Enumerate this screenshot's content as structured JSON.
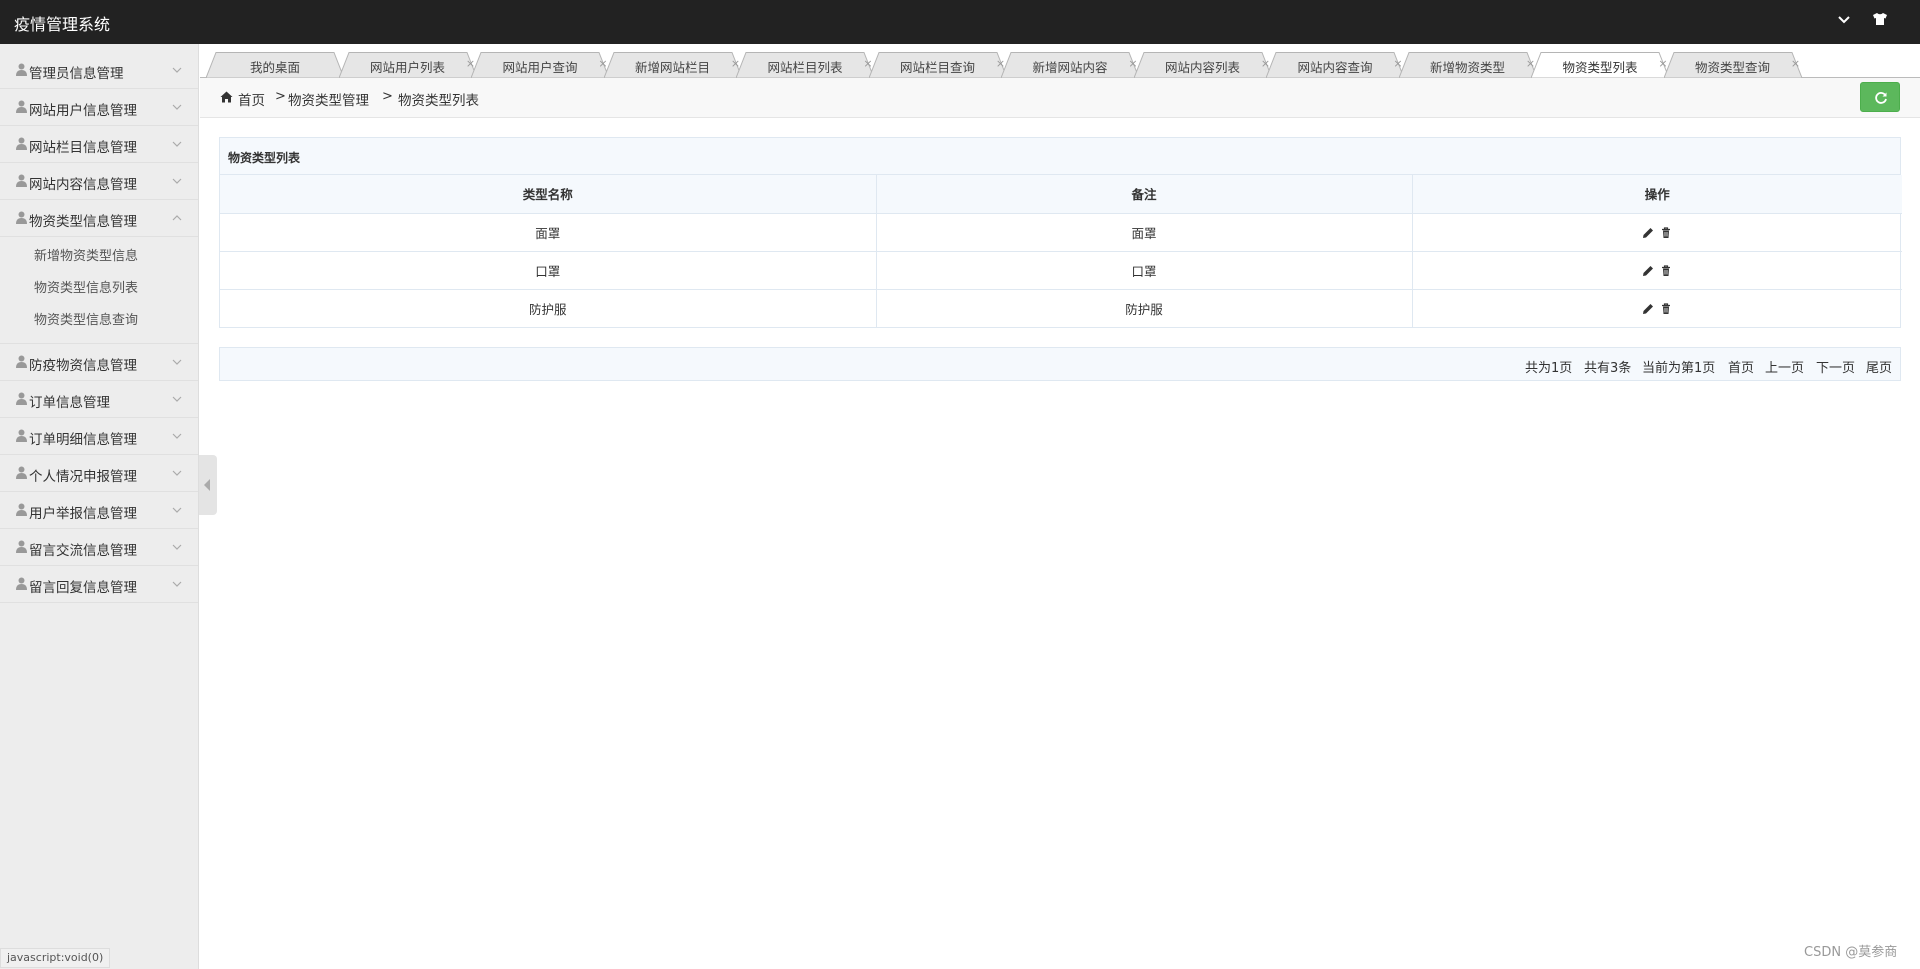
{
  "app": {
    "title": "疫情管理系统"
  },
  "sidebar": {
    "items": [
      {
        "label": "管理员信息管理"
      },
      {
        "label": "网站用户信息管理"
      },
      {
        "label": "网站栏目信息管理"
      },
      {
        "label": "网站内容信息管理"
      },
      {
        "label": "物资类型信息管理",
        "expanded": true,
        "children": [
          {
            "label": "新增物资类型信息"
          },
          {
            "label": "物资类型信息列表"
          },
          {
            "label": "物资类型信息查询"
          }
        ]
      },
      {
        "label": "防疫物资信息管理"
      },
      {
        "label": "订单信息管理"
      },
      {
        "label": "订单明细信息管理"
      },
      {
        "label": "个人情况申报管理"
      },
      {
        "label": "用户举报信息管理"
      },
      {
        "label": "留言交流信息管理"
      },
      {
        "label": "留言回复信息管理"
      }
    ]
  },
  "tabs": [
    {
      "label": "我的桌面",
      "closable": false
    },
    {
      "label": "网站用户列表",
      "closable": true
    },
    {
      "label": "网站用户查询",
      "closable": true
    },
    {
      "label": "新增网站栏目",
      "closable": true
    },
    {
      "label": "网站栏目列表",
      "closable": true
    },
    {
      "label": "网站栏目查询",
      "closable": true
    },
    {
      "label": "新增网站内容",
      "closable": true
    },
    {
      "label": "网站内容列表",
      "closable": true
    },
    {
      "label": "网站内容查询",
      "closable": true
    },
    {
      "label": "新增物资类型",
      "closable": true
    },
    {
      "label": "物资类型列表",
      "closable": true,
      "active": true
    },
    {
      "label": "物资类型查询",
      "closable": true
    }
  ],
  "tab_close_glyph": "×",
  "breadcrumb": {
    "items": [
      "首页",
      "物资类型管理",
      "物资类型列表"
    ],
    "separator": ">"
  },
  "panel": {
    "title": "物资类型列表",
    "columns": [
      "类型名称",
      "备注",
      "操作"
    ],
    "rows": [
      {
        "name": "面罩",
        "remark": "面罩"
      },
      {
        "name": "口罩",
        "remark": "口罩"
      },
      {
        "name": "防护服",
        "remark": "防护服"
      }
    ],
    "row_actions": [
      "pencil-icon",
      "trash-icon"
    ]
  },
  "pager": {
    "total_pages": "共为1页",
    "total_records": "共有3条",
    "current": "当前为第1页",
    "first": "首页",
    "prev": "上一页",
    "next": "下一页",
    "last": "尾页"
  },
  "statusbar": {
    "text": "javascript:void(0)"
  },
  "watermark": {
    "text": "CSDN @莫参商"
  },
  "colors": {
    "topbar": "#222222",
    "sidebar": "#ededed",
    "refresh_button": "#5cb85c",
    "table_border": "#dfe8f1",
    "table_header": "#f5f9fd"
  }
}
